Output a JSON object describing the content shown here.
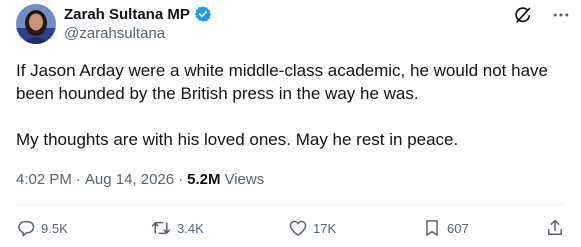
{
  "author": {
    "display_name": "Zarah Sultana MP",
    "handle": "@zarahsultana",
    "verified": true,
    "verified_color": "#1d9bf0"
  },
  "tweet": {
    "paragraphs": [
      "If Jason Arday were a white middle-class academic, he would not have been hounded by the British press in the way he was.",
      "My thoughts are with his loved ones. May he rest in peace."
    ]
  },
  "meta": {
    "time": "4:02 PM",
    "separator": "·",
    "date": "Aug 14, 2026",
    "views_count": "5.2M",
    "views_label": "Views"
  },
  "actions": {
    "replies": "9.5K",
    "reposts": "3.4K",
    "likes": "17K",
    "bookmarks": "607"
  },
  "icons": {
    "grok": "grok-icon",
    "more": "more-options-icon",
    "reply": "reply-icon",
    "repost": "repost-icon",
    "like": "like-icon",
    "bookmark": "bookmark-icon",
    "share": "share-icon"
  },
  "colors": {
    "text": "#0f1419",
    "secondary": "#536471",
    "accent": "#1d9bf0"
  }
}
